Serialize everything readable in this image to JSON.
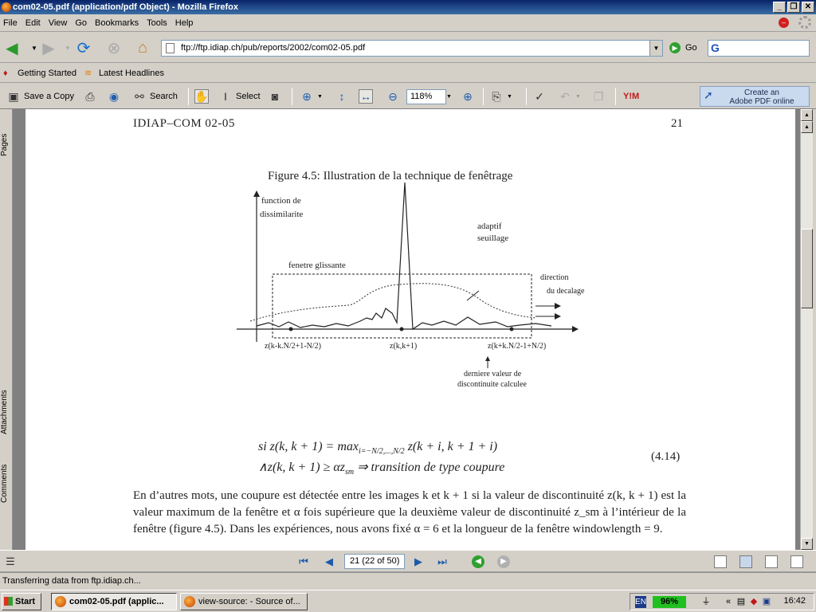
{
  "window": {
    "title": "com02-05.pdf (application/pdf Object) - Mozilla Firefox"
  },
  "menu": [
    "File",
    "Edit",
    "View",
    "Go",
    "Bookmarks",
    "Tools",
    "Help"
  ],
  "nav": {
    "url": "ftp://ftp.idiap.ch/pub/reports/2002/com02-05.pdf",
    "go_label": "Go"
  },
  "bookmarks": [
    "Getting Started",
    "Latest Headlines"
  ],
  "pdf_toolbar": {
    "save_copy": "Save a Copy",
    "search": "Search",
    "select": "Select",
    "zoom": "118%",
    "adobe_line1": "Create an",
    "adobe_line2": "Adobe PDF online"
  },
  "side_tabs": [
    "Pages",
    "Attachments",
    "Comments"
  ],
  "page": {
    "header_left": "IDIAP–COM 02-05",
    "header_right": "21",
    "figure_caption": "Figure 4.5: Illustration de la technique de fenêtrage",
    "fig_labels": {
      "ylabel1": "function de",
      "ylabel2": "dissimilarite",
      "adaptif": "adaptif",
      "seuillage": "seuillage",
      "window": "fenetre glissante",
      "direction1": "direction",
      "direction2": "du decalage",
      "x_left": "z(k-k.N/2+1-N/2)",
      "x_mid": "z(k,k+1)",
      "x_right": "z(k+k.N/2-1+N/2)",
      "last1": "derniere valeur de",
      "last2": "discontinuite calculee"
    },
    "eq_line1": "si z(k, k + 1) = max",
    "eq_sub": "i=−N/2,...,N/2",
    "eq_line1b": " z(k + i, k + 1 + i)",
    "eq_line2": "∧z(k, k + 1) ≥ αz",
    "eq_sub2": "sm",
    "eq_line2b": " ⇒ transition de type coupure",
    "eq_number": "(4.14)",
    "paragraph": "En d’autres mots, une coupure est détectée entre les images k et k + 1 si la valeur de discontinuité z(k, k + 1) est la valeur maximum de la fenêtre et α fois supérieure que la deuxième valeur de discontinuité z_sm à l’intérieur de la fenêtre (figure 4.5). Dans les expériences, nous avons fixé α = 6 et la longueur de la fenêtre windowlength = 9."
  },
  "pdf_nav": {
    "page_field": "21  (22 of 50)"
  },
  "status": "Transferring data from ftp.idiap.ch...",
  "taskbar": {
    "start": "Start",
    "tasks": [
      "com02-05.pdf (applic...",
      "view-source: - Source of..."
    ],
    "lang": "EN",
    "battery": "96%",
    "clock": "16:42"
  }
}
